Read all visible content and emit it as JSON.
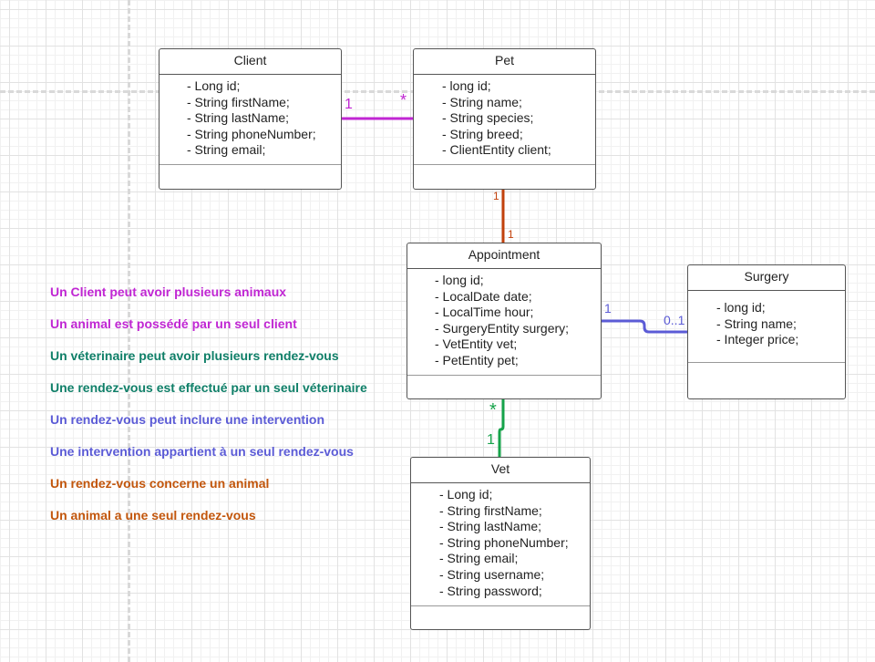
{
  "colors": {
    "client_pet": "#c026d3",
    "pet_appointment": "#c2410c",
    "appointment_surgery": "#5b5bd6",
    "appointment_vet": "#16a34a",
    "legend_purple": "#c026d3",
    "legend_teal": "#0f7f68",
    "legend_blue": "#5b5bd6",
    "legend_orange": "#c2560c"
  },
  "classes": {
    "client": {
      "name": "Client",
      "attributes": [
        "- Long id;",
        "- String firstName;",
        "- String lastName;",
        "- String phoneNumber;",
        "- String email;"
      ]
    },
    "pet": {
      "name": "Pet",
      "attributes": [
        "- long id;",
        "- String name;",
        "- String species;",
        "- String breed;",
        "- ClientEntity client;"
      ]
    },
    "appointment": {
      "name": "Appointment",
      "attributes": [
        "- long id;",
        "- LocalDate date;",
        "- LocalTime hour;",
        "- SurgeryEntity surgery;",
        "- VetEntity vet;",
        "- PetEntity pet;"
      ]
    },
    "surgery": {
      "name": "Surgery",
      "attributes": [
        "- long id;",
        "- String name;",
        "- Integer price;"
      ]
    },
    "vet": {
      "name": "Vet",
      "attributes": [
        "- Long id;",
        "- String firstName;",
        "- String lastName;",
        "- String phoneNumber;",
        "- String email;",
        "- String username;",
        "- String password;"
      ]
    }
  },
  "relations": {
    "client_pet": {
      "source": "1",
      "target": "*"
    },
    "pet_appointment": {
      "source": "1",
      "target": "1"
    },
    "appointment_surgery": {
      "source": "1",
      "target": "0..1"
    },
    "appointment_vet": {
      "source": "*",
      "target": "1"
    }
  },
  "legend": [
    {
      "text": "Un Client peut avoir plusieurs animaux",
      "color": "#c026d3"
    },
    {
      "text": "Un animal est possédé par un seul client",
      "color": "#c026d3"
    },
    {
      "text": "Un véterinaire peut avoir plusieurs rendez-vous",
      "color": "#0f7f68"
    },
    {
      "text": "Une rendez-vous est effectué par un seul véterinaire",
      "color": "#0f7f68"
    },
    {
      "text": "Un rendez-vous peut inclure une intervention",
      "color": "#5b5bd6"
    },
    {
      "text": "Une intervention appartient à un seul rendez-vous",
      "color": "#5b5bd6"
    },
    {
      "text": "Un rendez-vous concerne un animal",
      "color": "#c2560c"
    },
    {
      "text": "Un animal a une seul rendez-vous",
      "color": "#c2560c"
    }
  ]
}
